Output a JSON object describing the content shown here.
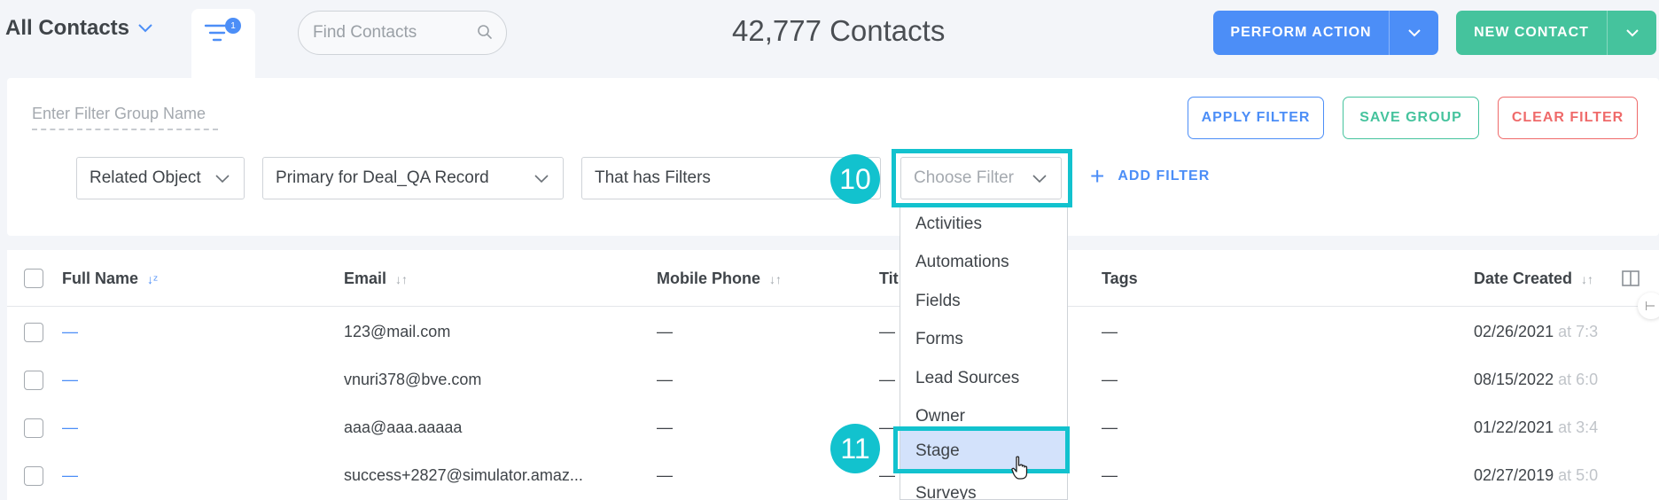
{
  "header": {
    "view_title": "All Contacts",
    "filter_badge_count": "1",
    "search_placeholder": "Find Contacts",
    "contact_count": "42,777 Contacts",
    "perform_action_label": "PERFORM ACTION",
    "new_contact_label": "NEW CONTACT"
  },
  "filter_panel": {
    "group_name_placeholder": "Enter Filter Group Name",
    "apply_label": "APPLY FILTER",
    "save_label": "SAVE GROUP",
    "clear_label": "CLEAR FILTER",
    "related_object": "Related Object",
    "primary_for": "Primary for Deal_QA Record",
    "that_has": "That has Filters",
    "choose_filter_placeholder": "Choose Filter",
    "add_filter_label": "ADD FILTER"
  },
  "steps": {
    "step_a": "10",
    "step_b": "11"
  },
  "dropdown": {
    "items": [
      "Activities",
      "Automations",
      "Fields",
      "Forms",
      "Lead Sources",
      "Owner",
      "Stage",
      "Surveys"
    ],
    "selected": "Stage"
  },
  "table": {
    "columns": {
      "full_name": "Full Name",
      "email": "Email",
      "mobile_phone": "Mobile Phone",
      "title": "Tit",
      "tags": "Tags",
      "date_created": "Date Created"
    },
    "rows": [
      {
        "full_name": "—",
        "email": "123@mail.com",
        "mobile_phone": "—",
        "title": "—",
        "tags": "—",
        "date": "02/26/2021",
        "time_fragment": " at 7:3"
      },
      {
        "full_name": "—",
        "email": "vnuri378@bve.com",
        "mobile_phone": "—",
        "title": "—",
        "tags": "—",
        "date": "08/15/2022",
        "time_fragment": " at 6:0"
      },
      {
        "full_name": "—",
        "email": "aaa@aaa.aaaaa",
        "mobile_phone": "—",
        "title": "—",
        "tags": "—",
        "date": "01/22/2021",
        "time_fragment": " at 3:4"
      },
      {
        "full_name": "—",
        "email": "success+2827@simulator.amaz...",
        "mobile_phone": "—",
        "title": "—",
        "tags": "—",
        "date": "02/27/2019",
        "time_fragment": " at 5:0"
      }
    ]
  },
  "colors": {
    "primary_blue": "#4c8ef7",
    "green": "#45c39d",
    "red": "#ef6a6a",
    "highlight_teal": "#12c2ce",
    "selected_bg": "#d3e2fb"
  }
}
